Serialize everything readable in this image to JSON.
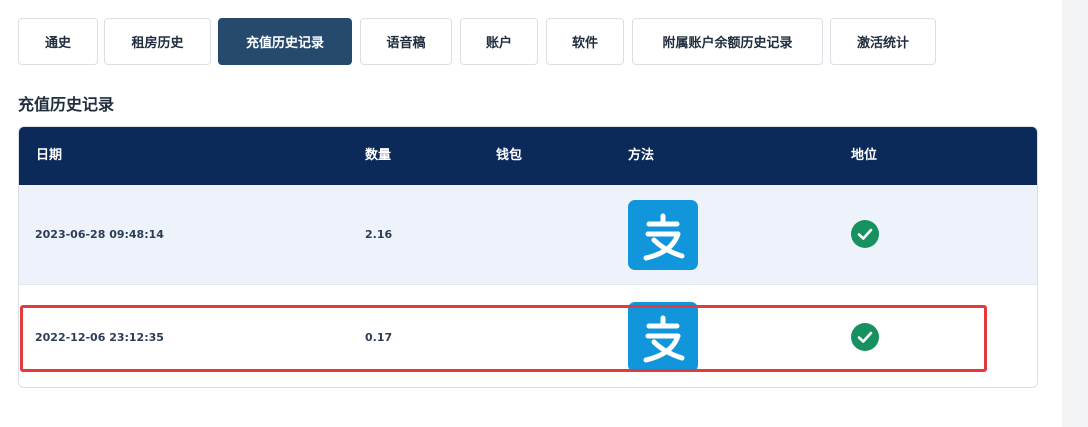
{
  "tabs": [
    {
      "label": "通史",
      "active": false
    },
    {
      "label": "租房历史",
      "active": false
    },
    {
      "label": "充值历史记录",
      "active": true
    },
    {
      "label": "语音稿",
      "active": false
    },
    {
      "label": "账户",
      "active": false
    },
    {
      "label": "软件",
      "active": false
    },
    {
      "label": "附属账户余额历史记录",
      "active": false
    },
    {
      "label": "激活统计",
      "active": false
    }
  ],
  "section_title": "充值历史记录",
  "table": {
    "headers": {
      "date": "日期",
      "amount": "数量",
      "wallet": "钱包",
      "method": "方法",
      "status": "地位"
    },
    "rows": [
      {
        "date": "2023-06-28 09:48:14",
        "amount": "2.16",
        "wallet": "",
        "method_icon": "alipay-icon",
        "status_icon": "check-circle-icon",
        "highlighted": false
      },
      {
        "date": "2022-12-06 23:12:35",
        "amount": "0.17",
        "wallet": "",
        "method_icon": "alipay-icon",
        "status_icon": "check-circle-icon",
        "highlighted": true
      }
    ]
  },
  "colors": {
    "header_bg": "#0b2a5a",
    "active_tab": "#264a6e",
    "alipay_blue": "#1296db",
    "success_green": "#17915f",
    "highlight_red": "#e23b3b"
  }
}
